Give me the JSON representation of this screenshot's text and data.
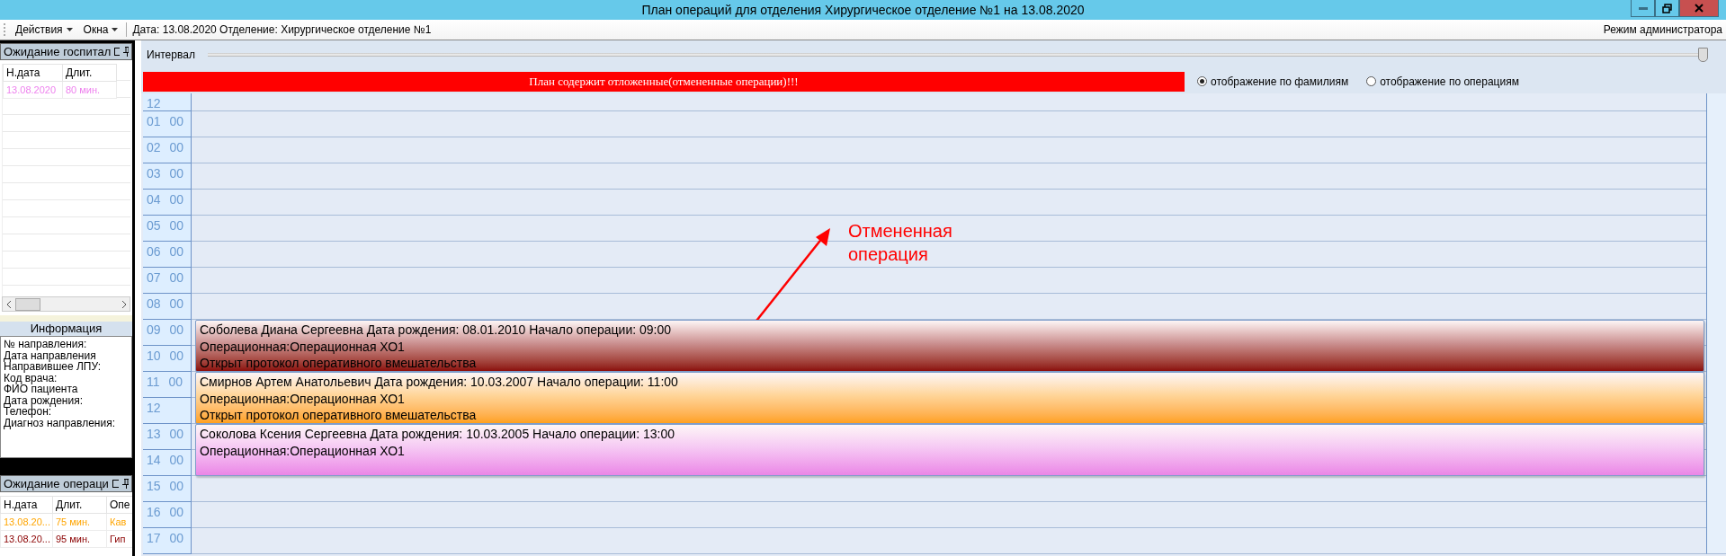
{
  "window": {
    "title": "План операций для отделения Хирургическое отделение №1 на 13.08.2020"
  },
  "toolbar": {
    "menus": [
      {
        "label": "Действия"
      },
      {
        "label": "Окна"
      }
    ],
    "info": "Дата: 13.08.2020 Отделение: Хирургическое отделение №1",
    "mode": "Режим администратора"
  },
  "hospital_queue": {
    "title": "Ожидание госпитал",
    "columns": [
      "Н.дата",
      "Длит."
    ],
    "rows": [
      {
        "cells": [
          "13.08.2020",
          "80 мин."
        ],
        "color": "#ee82ee"
      }
    ]
  },
  "info": {
    "title": "Информация",
    "fields": [
      "№ направления:",
      "Дата направления",
      "Направившее ЛПУ:",
      "Код врача:",
      "ФИО пациента",
      "Дата рождения:",
      "Телефон:",
      "Диагноз направления:"
    ]
  },
  "operation_queue": {
    "title": "Ожидание операци",
    "columns": [
      "Н.дата",
      "Длит.",
      "Опе"
    ],
    "rows": [
      {
        "cells": [
          "13.08.20...",
          "75 мин.",
          "Кав"
        ],
        "color": "#ffa500"
      },
      {
        "cells": [
          "13.08.20...",
          "95 мин.",
          "Гип"
        ],
        "color": "#8b0000"
      }
    ]
  },
  "interval": {
    "label": "Интервал",
    "level": 1
  },
  "banner": "План содержит отложенные(отмененные операции)!!!",
  "view_modes": [
    {
      "label": "отображение по фамилиям",
      "selected": true
    },
    {
      "label": "отображение по операциям",
      "selected": false
    }
  ],
  "schedule": {
    "hours": [
      {
        "hour": "12"
      },
      {
        "hour": "01",
        "minutes": "00"
      },
      {
        "hour": "02",
        "minutes": "00"
      },
      {
        "hour": "03",
        "minutes": "00"
      },
      {
        "hour": "04",
        "minutes": "00"
      },
      {
        "hour": "05",
        "minutes": "00"
      },
      {
        "hour": "06",
        "minutes": "00"
      },
      {
        "hour": "07",
        "minutes": "00"
      },
      {
        "hour": "08",
        "minutes": "00"
      },
      {
        "hour": "09",
        "minutes": "00",
        "operation": {
          "color": "#8b0a0a",
          "lines": [
            "Соболева Диана Сергеевна Дата рождения: 08.01.2010 Начало операции: 09:00",
            "Операционная:Операционная ХО1",
            "Открыт протокол оперативного вмешательства"
          ]
        }
      },
      {
        "hour": "10",
        "minutes": "00"
      },
      {
        "hour": "11",
        "minutes": "00",
        "operation": {
          "color": "#ffa11a",
          "lines": [
            "Смирнов Артем Анатольевич Дата рождения: 10.03.2007 Начало операции: 11:00",
            "Операционная:Операционная ХО1",
            "Открыт протокол оперативного вмешательства"
          ]
        }
      },
      {
        "hour": "12"
      },
      {
        "hour": "13",
        "minutes": "00",
        "operation": {
          "color": "#ea86e6",
          "lines": [
            "Соколова Ксения Сергеевна Дата рождения: 10.03.2005 Начало операции: 13:00",
            "Операционная:Операционная ХО1"
          ]
        }
      },
      {
        "hour": "14",
        "minutes": "00"
      },
      {
        "hour": "15",
        "minutes": "00"
      },
      {
        "hour": "16",
        "minutes": "00"
      },
      {
        "hour": "17",
        "minutes": "00"
      }
    ]
  },
  "annotation": {
    "text": "Отмененная операция"
  }
}
